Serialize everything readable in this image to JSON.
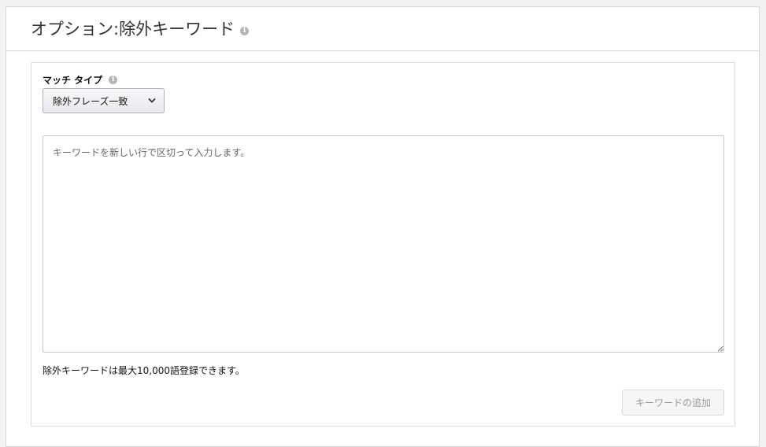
{
  "header": {
    "title": "オプション:除外キーワード",
    "info_icon": "info-icon"
  },
  "match_type": {
    "label": "マッチ タイプ",
    "info_icon": "info-icon",
    "selected": "除外フレーズ一致",
    "chevron_icon": "chevron-down-icon"
  },
  "keywords": {
    "placeholder": "キーワードを新しい行で区切って入力します。",
    "value": ""
  },
  "limit_note": "除外キーワードは最大10,000語登録できます。",
  "add_button": {
    "label": "キーワードの追加",
    "disabled": true
  },
  "colors": {
    "panel_border": "#d5d9d9",
    "info_icon": "#b5b5b5",
    "disabled_text": "#999999"
  }
}
